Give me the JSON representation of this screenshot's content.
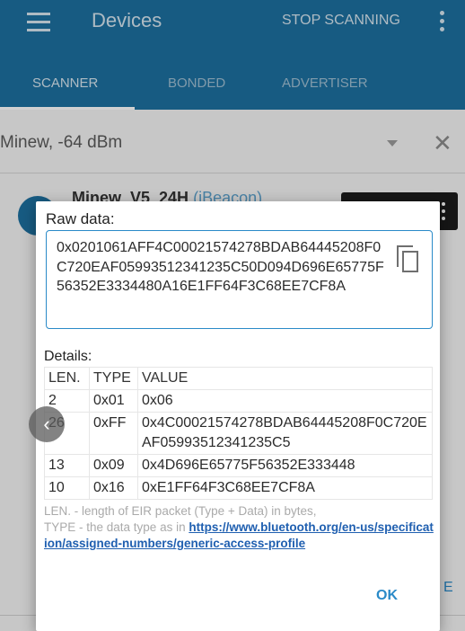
{
  "app": {
    "title": "Devices",
    "stop_label": "STOP SCANNING",
    "tabs": [
      {
        "label": "SCANNER"
      },
      {
        "label": "BONDED"
      },
      {
        "label": "ADVERTISER"
      }
    ],
    "filter_text": "Minew, -64 dBm",
    "device": {
      "name": "Minew_V5_24H",
      "type": "(iBeacon)"
    },
    "partial_letter": "E"
  },
  "dialog": {
    "raw_title": "Raw data:",
    "raw_value": "0x0201061AFF4C00021574278BDAB64445208F0C720EAF05993512341235C50D094D696E65775F56352E3334480A16E1FF64F3C68EE7CF8A",
    "details_title": "Details:",
    "table": {
      "headers": [
        "LEN.",
        "TYPE",
        "VALUE"
      ],
      "rows": [
        {
          "len": "2",
          "type": "0x01",
          "value": "0x06"
        },
        {
          "len": "26",
          "type": "0xFF",
          "value": "0x4C00021574278BDAB64445208F0C720EAF05993512341235C5"
        },
        {
          "len": "13",
          "type": "0x09",
          "value": "0x4D696E65775F56352E333448"
        },
        {
          "len": "10",
          "type": "0x16",
          "value": "0xE1FF64F3C68EE7CF8A"
        }
      ]
    },
    "footnote_line1": "LEN. - length of EIR packet (Type + Data) in bytes,",
    "footnote_line2": "TYPE - the data type as in ",
    "footnote_link": "https://www.bluetooth.org/en-us/specification/assigned-numbers/generic-access-profile",
    "ok_label": "OK"
  },
  "colors": {
    "primary": "#1d6f9f",
    "accent": "#2a8ac8",
    "link": "#1f5fb0"
  }
}
